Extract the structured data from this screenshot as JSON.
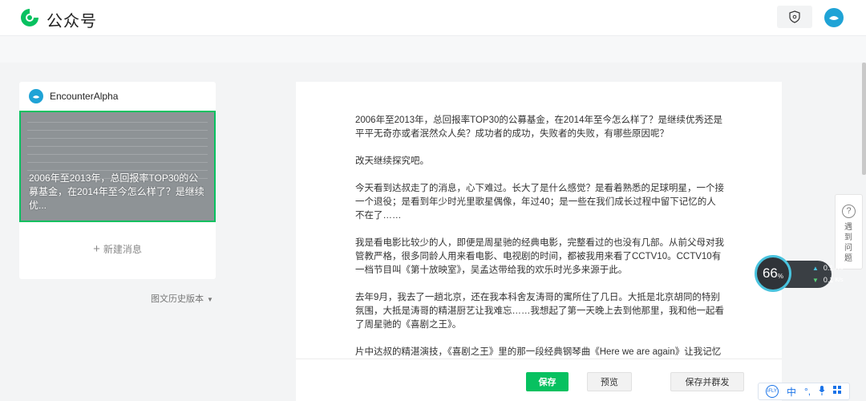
{
  "header": {
    "brand": "公众号"
  },
  "left_panel": {
    "account_name": "EncounterAlpha",
    "cover_title": "2006年至2013年，总回报率TOP30的公募基金，在2014年至今怎么样了？是继续优...",
    "new_message_label": "新建消息",
    "history_label": "图文历史版本"
  },
  "article": {
    "paragraphs": [
      "2006年至2013年，总回报率TOP30的公募基金，在2014年至今怎么样了？是继续优秀还是平平无奇亦或者泯然众人矣？成功者的成功，失败者的失败，有哪些原因呢？",
      "改天继续探究吧。",
      "今天看到达叔走了的消息，心下难过。长大了是什么感觉？是看着熟悉的足球明星，一个接一个退役；是看到年少时光里歌星偶像，年过40；是一些在我们成长过程中留下记忆的人不在了……",
      "我是看电影比较少的人，即便是周星驰的经典电影，完整看过的也没有几部。从前父母对我管教严格，很多同龄人用来看电影、电视剧的时间，都被我用来看了CCTV10。CCTV10有一档节目叫《第十放映室》，吴孟达带给我的欢乐时光多来源于此。",
      "去年9月，我去了一趟北京，还在我本科舍友涛哥的寓所住了几日。大抵是北京胡同的特别氛围，大抵是涛哥的精湛厨艺让我难忘……我想起了第一天晚上去到他那里，我和他一起看了周星驰的《喜剧之王》。",
      "片中达叔的精湛演技，《喜剧之王》里的那一段经典钢琴曲《Here we are again》让我记忆"
    ]
  },
  "actions": {
    "save": "保存",
    "preview": "预览",
    "save_publish": "保存并群发"
  },
  "help": {
    "icon_char": "?",
    "label": "遇到问题"
  },
  "speed_widget": {
    "percent": "66",
    "percent_unit": "%",
    "up": "0.1",
    "down": "0.1",
    "unit": "K/s"
  },
  "ime": {
    "logo": "iFLY",
    "lang": "中",
    "punct": "°,",
    "mic": "🎤",
    "grid": "▦"
  },
  "colors": {
    "accent_green": "#07c160",
    "brand_blue": "#1fa3d6"
  }
}
